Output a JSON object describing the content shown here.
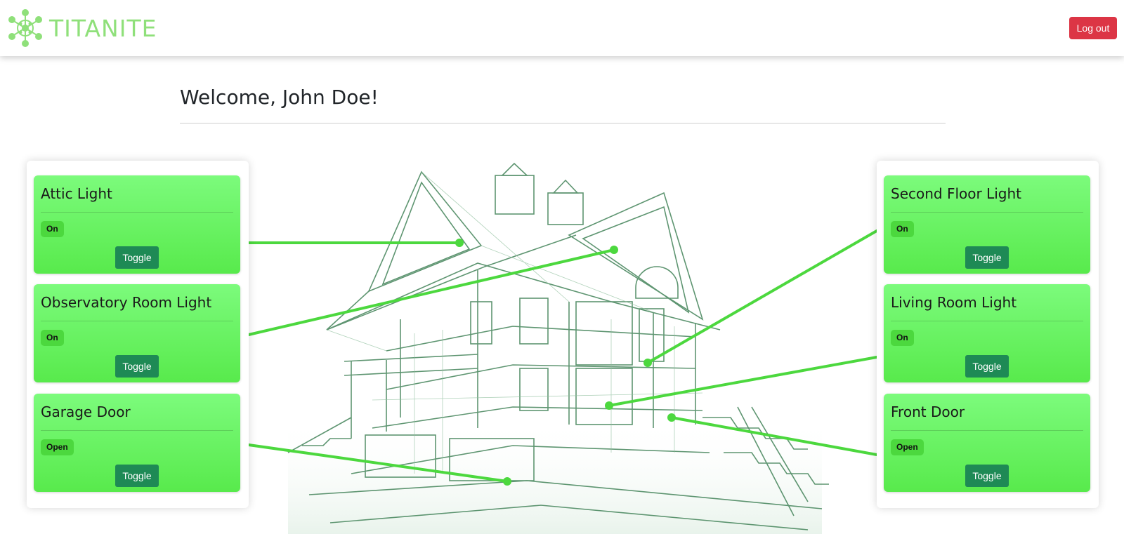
{
  "brand": {
    "name": "TITANITE",
    "logo_icon": "molecule-logo-icon",
    "color": "#8fe07a"
  },
  "header": {
    "logout_label": "Log out"
  },
  "welcome": {
    "text": "Welcome, John Doe!"
  },
  "colors": {
    "card_top": "#7cfb7c",
    "card_bottom": "#58ea4c",
    "toggle": "#1e8a55",
    "connector": "#4cd83e",
    "logout": "#dc3545"
  },
  "devices_left": [
    {
      "name": "Attic Light",
      "status": "On",
      "toggle_label": "Toggle"
    },
    {
      "name": "Observatory Room Light",
      "status": "On",
      "toggle_label": "Toggle"
    },
    {
      "name": "Garage Door",
      "status": "Open",
      "toggle_label": "Toggle"
    }
  ],
  "devices_right": [
    {
      "name": "Second Floor Light",
      "status": "On",
      "toggle_label": "Toggle"
    },
    {
      "name": "Living Room Light",
      "status": "On",
      "toggle_label": "Toggle"
    },
    {
      "name": "Front Door",
      "status": "Open",
      "toggle_label": "Toggle"
    }
  ]
}
